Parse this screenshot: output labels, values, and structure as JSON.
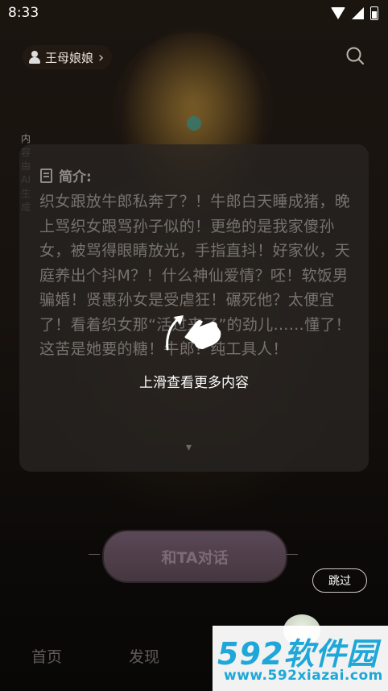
{
  "status_bar": {
    "time": "8:33"
  },
  "header": {
    "author_name": "王母娘娘",
    "author_chevron": "›",
    "search_icon": "search-icon"
  },
  "ai_note": "内容由AI生成",
  "intro_card": {
    "heading": "简介:",
    "body": "织女跟放牛郎私奔了？！牛郎白天睡成猪，晚上骂织女跟骂孙子似的！更绝的是我家傻孙女，被骂得眼睛放光，手指直抖！好家伙，天庭养出个抖M？！什么神仙爱情？呸！软饭男骗婚！贤惠孙女是受虐狂！碾死他？太便宜了！看着织女那“活过来了”的劲儿……懂了！这苦是她要的糖！牛郎？纯工具人！"
  },
  "swipe_hint": {
    "text": "上滑查看更多内容",
    "icon": "swipe-up-hand-icon"
  },
  "chat_button": {
    "label": "和TA对话"
  },
  "skip_button": {
    "label": "跳过"
  },
  "tab_bar": {
    "home": "首页",
    "discover": "发现"
  },
  "watermark": {
    "brand": "592软件园",
    "url": "www.592xiazai.com"
  },
  "colors": {
    "watermark_blue": "#1ea7d8",
    "watermark_red": "#e0312a",
    "chat_button": "#5a4856"
  }
}
